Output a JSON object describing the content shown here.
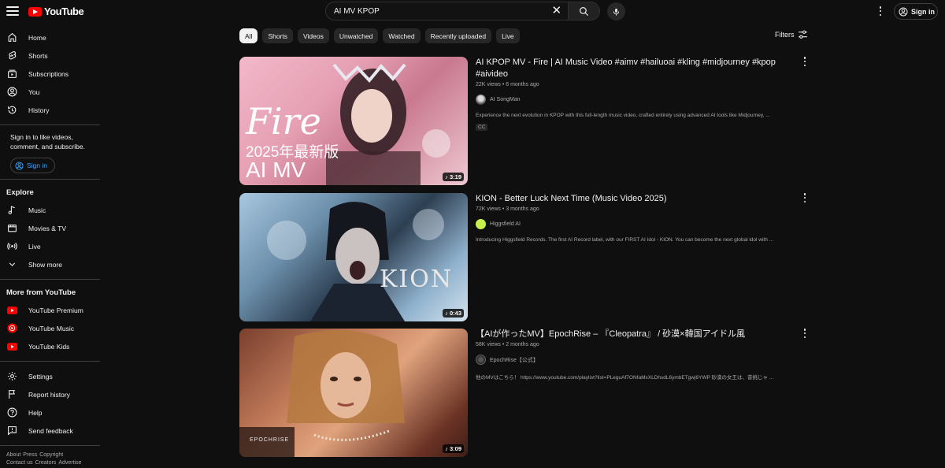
{
  "header": {
    "logo_text": "YouTube",
    "search_value": "AI MV KPOP",
    "signin_label": "Sign in"
  },
  "sidebar": {
    "main": [
      {
        "label": "Home",
        "icon": "home-icon"
      },
      {
        "label": "Shorts",
        "icon": "shorts-icon"
      },
      {
        "label": "Subscriptions",
        "icon": "subscriptions-icon"
      },
      {
        "label": "You",
        "icon": "you-icon"
      },
      {
        "label": "History",
        "icon": "history-icon"
      }
    ],
    "signin_note": "Sign in to like videos, comment, and subscribe.",
    "signin_label": "Sign in",
    "explore_heading": "Explore",
    "explore": [
      {
        "label": "Music",
        "icon": "music-icon"
      },
      {
        "label": "Movies & TV",
        "icon": "movies-icon"
      },
      {
        "label": "Live",
        "icon": "live-icon"
      },
      {
        "label": "Show more",
        "icon": "chevron-down-icon"
      }
    ],
    "more_heading": "More from YouTube",
    "more": [
      {
        "label": "YouTube Premium",
        "icon": "youtube-premium-icon"
      },
      {
        "label": "YouTube Music",
        "icon": "youtube-music-icon"
      },
      {
        "label": "YouTube Kids",
        "icon": "youtube-kids-icon"
      }
    ],
    "settings": [
      {
        "label": "Settings",
        "icon": "gear-icon"
      },
      {
        "label": "Report history",
        "icon": "flag-icon"
      },
      {
        "label": "Help",
        "icon": "help-icon"
      },
      {
        "label": "Send feedback",
        "icon": "feedback-icon"
      }
    ],
    "footer": [
      "About",
      "Press",
      "Copyright",
      "Contact us",
      "Creators",
      "Advertise"
    ]
  },
  "chips": [
    "All",
    "Shorts",
    "Videos",
    "Unwatched",
    "Watched",
    "Recently uploaded",
    "Live"
  ],
  "filters_label": "Filters",
  "results": [
    {
      "title": "AI KPOP MV - Fire | AI Music Video #aimv #hailuoai #kling #midjourney #kpop #aivideo",
      "meta": "22K views • 6 months ago",
      "channel": "AI SongMan",
      "description": "Experience the next evolution in KPOP with this full-length music video, crafted entirely using advanced AI tools like Midjourney, ...",
      "badge": "CC",
      "duration": "♪ 3:19",
      "thumb_text_1": "Fire",
      "thumb_text_2": "2025年最新版",
      "thumb_text_3": "AI MV"
    },
    {
      "title": "KION - Better Luck Next Time (Music Video 2025)",
      "meta": "72K views • 3 months ago",
      "channel": "Higgsfield AI",
      "description": "Introducing Higgsfield Records. The first AI Record label, with our FIRST AI Idol - KION. You can become the next global idol with ...",
      "duration": "♪ 0:43",
      "thumb_text_1": "KION"
    },
    {
      "title": "【AIが作ったMV】EpochRise – 『Cleopatra』 / 砂漠×韓国アイドル風",
      "meta": "58K views • 2 months ago",
      "channel": "EpochRise【公式】",
      "description": "他のMVはこちら！ https://www.youtube.com/playlist?list=PLeguAf7ONfaMxXLDhsdL6ymbETgwj6YWP 砂漠の女王は、昔挑じゃ ...",
      "duration": "♪ 3:09",
      "thumb_text_1": "EPOCHRISE"
    }
  ]
}
